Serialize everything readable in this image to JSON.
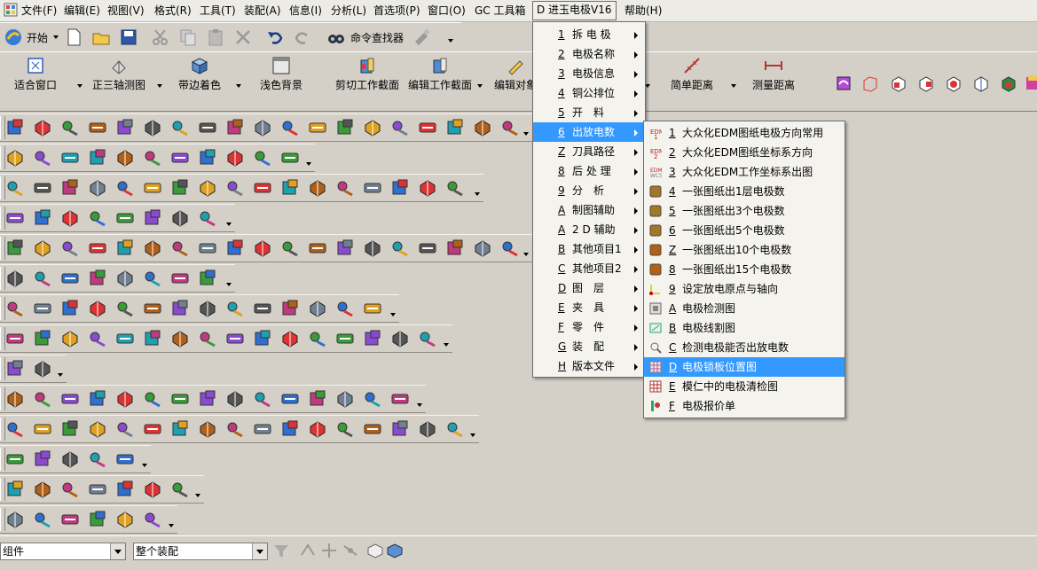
{
  "menubar": {
    "items": [
      "文件(F)",
      "编辑(E)",
      "视图(V)",
      "格式(R)",
      "工具(T)",
      "装配(A)",
      "信息(I)",
      "分析(L)",
      "首选项(P)",
      "窗口(O)",
      "GC 工具箱",
      "D 进玉电极V16",
      "帮助(H)"
    ]
  },
  "toolbar1": {
    "start_label": "开始",
    "command_finder_label": "命令查找器"
  },
  "toolbar2": {
    "buttons": [
      "适合窗口",
      "正三轴测图",
      "带边着色",
      "浅色背景",
      "剪切工作截面",
      "编辑工作截面",
      "编辑对象",
      "简单距离",
      "测量距离"
    ]
  },
  "main_menu": {
    "items": [
      {
        "num": "1",
        "label": "拆 电 极",
        "arrow": true
      },
      {
        "num": "2",
        "label": "电极名称",
        "arrow": true
      },
      {
        "num": "3",
        "label": "电极信息",
        "arrow": true
      },
      {
        "num": "4",
        "label": "铜公排位",
        "arrow": true
      },
      {
        "num": "5",
        "label": "开　料",
        "arrow": true
      },
      {
        "num": "6",
        "label": "出放电数",
        "arrow": true,
        "selected": true
      },
      {
        "num": "Z",
        "label": "刀具路径",
        "arrow": true
      },
      {
        "num": "8",
        "label": "后 处 理",
        "arrow": true
      },
      {
        "num": "9",
        "label": "分　析",
        "arrow": true
      },
      {
        "num": "A",
        "label": "制图辅助",
        "arrow": true
      },
      {
        "num": "A",
        "label": "2 D 辅助",
        "arrow": true
      },
      {
        "num": "B",
        "label": "其他项目1",
        "arrow": true
      },
      {
        "num": "C",
        "label": "其他项目2",
        "arrow": true
      },
      {
        "num": "D",
        "label": "图　层",
        "arrow": true
      },
      {
        "num": "E",
        "label": "夹　具",
        "arrow": true
      },
      {
        "num": "F",
        "label": "零　件",
        "arrow": true
      },
      {
        "num": "G",
        "label": "装　配",
        "arrow": true
      },
      {
        "num": "H",
        "label": "版本文件",
        "arrow": true
      }
    ]
  },
  "sub_menu": {
    "items": [
      {
        "num": "1",
        "label": "大众化EDM图纸电极方向常用",
        "icon": "edm-1-icon"
      },
      {
        "num": "2",
        "label": "大众化EDM图纸坐标系方向",
        "icon": "edm-2-icon"
      },
      {
        "num": "3",
        "label": "大众化EDM工作坐标系出图",
        "icon": "edm-wcs-icon"
      },
      {
        "num": "4",
        "label": "一张图纸出1层电极数",
        "icon": "sheet-1-icon"
      },
      {
        "num": "5",
        "label": "一张图纸出3个电极数",
        "icon": "sheet-3-icon"
      },
      {
        "num": "6",
        "label": "一张图纸出5个电极数",
        "icon": "sheet-5-icon"
      },
      {
        "num": "Z",
        "label": "一张图纸出10个电极数",
        "icon": "sheet-10-icon"
      },
      {
        "num": "8",
        "label": "一张图纸出15个电极数",
        "icon": "sheet-15-icon"
      },
      {
        "num": "9",
        "label": "设定放电原点与轴向",
        "icon": "origin-axis-icon"
      },
      {
        "num": "A",
        "label": "电极检测图",
        "icon": "inspect-icon"
      },
      {
        "num": "B",
        "label": "电极线割图",
        "icon": "wire-cut-icon"
      },
      {
        "num": "C",
        "label": "检测电极能否出放电数",
        "icon": "check-icon"
      },
      {
        "num": "D",
        "label": "电极锁板位置图",
        "icon": "lock-plate-icon",
        "selected": true
      },
      {
        "num": "E",
        "label": "模仁中的电极清检图",
        "icon": "grid-icon"
      },
      {
        "num": "F",
        "label": "电极报价单",
        "icon": "quote-icon"
      }
    ]
  },
  "statusbar": {
    "combo1_value": "组件",
    "combo2_value": "整个装配"
  },
  "colors": {
    "menu_highlight": "#3399ff",
    "toolbar_bg": "#d4d0c8"
  }
}
